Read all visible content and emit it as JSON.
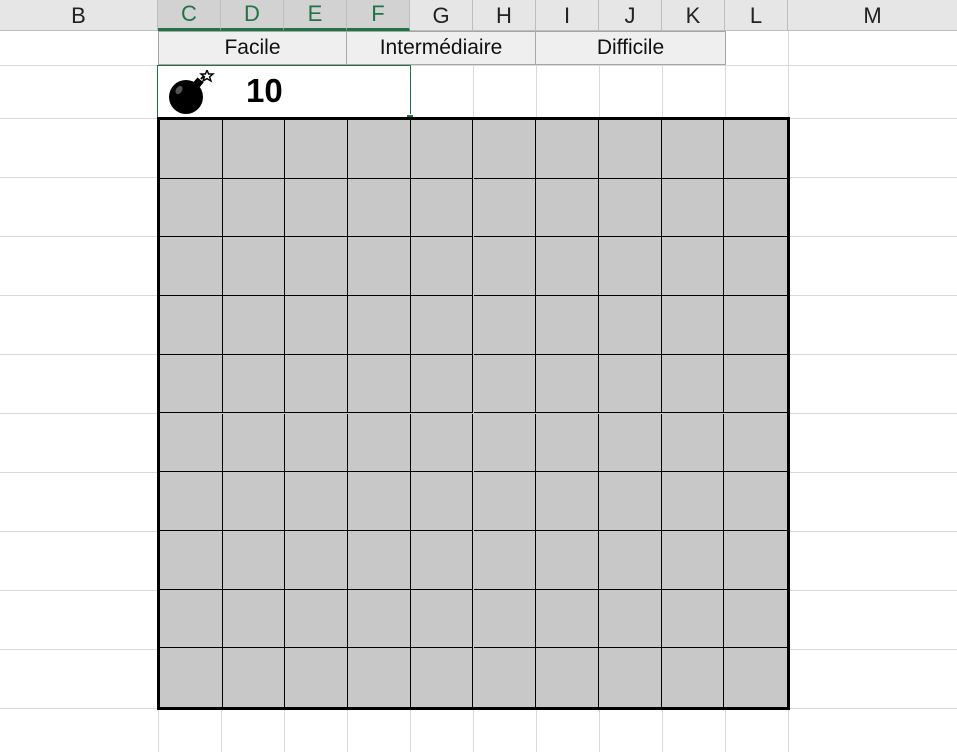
{
  "columns": [
    {
      "id": "B",
      "label": "B",
      "selected": false
    },
    {
      "id": "C",
      "label": "C",
      "selected": true
    },
    {
      "id": "D",
      "label": "D",
      "selected": true
    },
    {
      "id": "E",
      "label": "E",
      "selected": true
    },
    {
      "id": "F",
      "label": "F",
      "selected": true
    },
    {
      "id": "G",
      "label": "G",
      "selected": false
    },
    {
      "id": "H",
      "label": "H",
      "selected": false
    },
    {
      "id": "I",
      "label": "I",
      "selected": false
    },
    {
      "id": "J",
      "label": "J",
      "selected": false
    },
    {
      "id": "K",
      "label": "K",
      "selected": false
    },
    {
      "id": "L",
      "label": "L",
      "selected": false
    },
    {
      "id": "M",
      "label": "M",
      "selected": false
    }
  ],
  "levels": {
    "easy": "Facile",
    "intermediate": "Intermédiaire",
    "hard": "Difficile"
  },
  "counter": {
    "icon": "bomb-icon",
    "mines": "10"
  },
  "board": {
    "rows": 10,
    "cols": 10,
    "cell_state": "hidden"
  },
  "colors": {
    "accent": "#217346",
    "cell": "#c8c8c8",
    "board_border": "#000000",
    "button_bg": "#efefef"
  }
}
